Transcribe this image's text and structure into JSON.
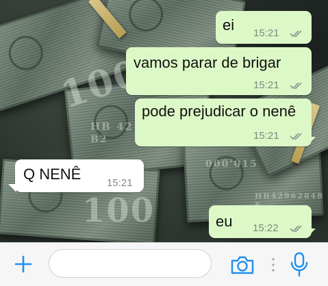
{
  "messages": [
    {
      "direction": "outgoing",
      "text": "ei",
      "time": "15:21",
      "status": "read"
    },
    {
      "direction": "outgoing",
      "text": "vamos parar de brigar",
      "time": "15:21",
      "status": "read"
    },
    {
      "direction": "outgoing",
      "text": "pode prejudicar o nenê",
      "time": "15:21",
      "status": "read"
    },
    {
      "direction": "incoming",
      "text": "Q NENÊ",
      "time": "15:21"
    },
    {
      "direction": "outgoing",
      "text": "eu",
      "time": "15:22",
      "status": "read"
    }
  ],
  "input": {
    "value": "",
    "placeholder": ""
  },
  "icons": {
    "attach": "plus-icon",
    "camera": "camera-icon",
    "more": "vertical-dots-icon",
    "mic": "microphone-icon",
    "read_receipt": "double-check-icon"
  },
  "colors": {
    "outgoing_bubble": "#dcf8c6",
    "incoming_bubble": "#ffffff",
    "accent": "#1f8ef1",
    "ticks": "#8e9a91"
  },
  "wallpaper": {
    "bill_marks": [
      "100",
      "HB 42",
      "B2",
      "000'015",
      "HB42962848 K"
    ]
  }
}
